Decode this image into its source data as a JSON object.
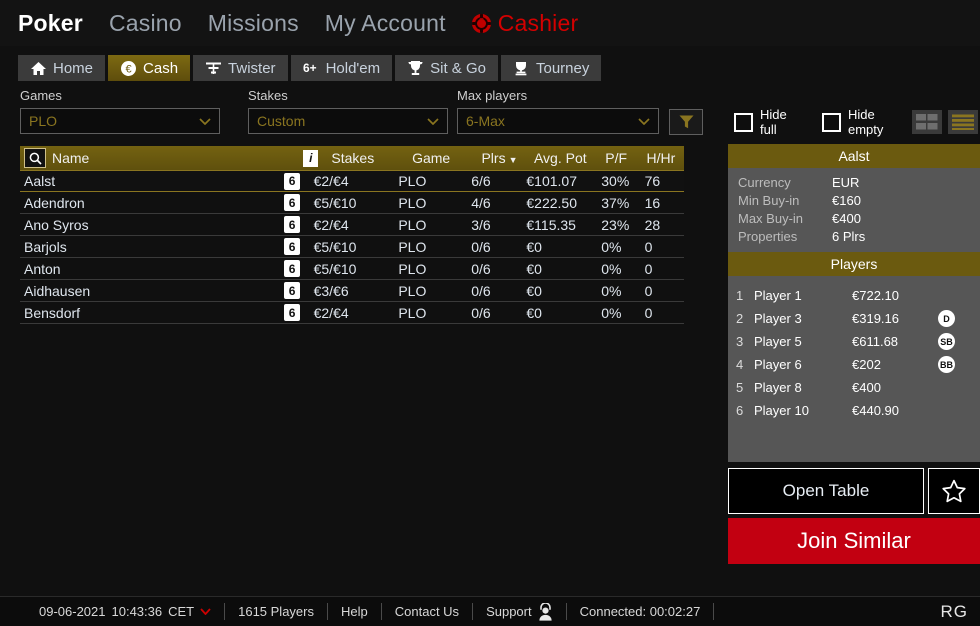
{
  "nav": {
    "items": [
      {
        "label": "Poker",
        "active": true
      },
      {
        "label": "Casino",
        "active": false
      },
      {
        "label": "Missions",
        "active": false
      },
      {
        "label": "My Account",
        "active": false
      }
    ],
    "cashier_label": "Cashier",
    "cashier_icon": "poker-chip-icon"
  },
  "tabs": [
    {
      "label": "Home",
      "icon": "home-icon",
      "active": false
    },
    {
      "label": "Cash",
      "icon": "euro-coin-icon",
      "active": true
    },
    {
      "label": "Twister",
      "icon": "twister-icon",
      "active": false
    },
    {
      "label": "Hold'em",
      "icon": "six-plus-icon",
      "active": false
    },
    {
      "label": "Sit & Go",
      "icon": "trophy-icon",
      "active": false
    },
    {
      "label": "Tourney",
      "icon": "cup-icon",
      "active": false
    }
  ],
  "filters": {
    "games": {
      "label": "Games",
      "value": "PLO"
    },
    "stakes": {
      "label": "Stakes",
      "value": "Custom"
    },
    "max_players": {
      "label": "Max players",
      "value": "6-Max"
    },
    "filter_icon": "funnel-icon"
  },
  "lobby": {
    "headers": {
      "search_icon": "magnifier-icon",
      "name": "Name",
      "info_icon": "info-icon",
      "stakes": "Stakes",
      "game": "Game",
      "plrs": "Plrs",
      "sort_indicator": "▼",
      "avg_pot": "Avg. Pot",
      "pf": "P/F",
      "hhr": "H/Hr"
    },
    "rows": [
      {
        "name": "Aalst",
        "badge": "6",
        "stakes": "€2/€4",
        "game": "PLO",
        "plrs": "6/6",
        "avg_pot": "€101.07",
        "pf": "30%",
        "hhr": "76",
        "selected": true
      },
      {
        "name": "Adendron",
        "badge": "6",
        "stakes": "€5/€10",
        "game": "PLO",
        "plrs": "4/6",
        "avg_pot": "€222.50",
        "pf": "37%",
        "hhr": "16",
        "selected": false
      },
      {
        "name": "Ano Syros",
        "badge": "6",
        "stakes": "€2/€4",
        "game": "PLO",
        "plrs": "3/6",
        "avg_pot": "€115.35",
        "pf": "23%",
        "hhr": "28",
        "selected": false
      },
      {
        "name": "Barjols",
        "badge": "6",
        "stakes": "€5/€10",
        "game": "PLO",
        "plrs": "0/6",
        "avg_pot": "€0",
        "pf": "0%",
        "hhr": "0",
        "selected": false
      },
      {
        "name": "Anton",
        "badge": "6",
        "stakes": "€5/€10",
        "game": "PLO",
        "plrs": "0/6",
        "avg_pot": "€0",
        "pf": "0%",
        "hhr": "0",
        "selected": false
      },
      {
        "name": "Aidhausen",
        "badge": "6",
        "stakes": "€3/€6",
        "game": "PLO",
        "plrs": "0/6",
        "avg_pot": "€0",
        "pf": "0%",
        "hhr": "0",
        "selected": false
      },
      {
        "name": "Bensdorf",
        "badge": "6",
        "stakes": "€2/€4",
        "game": "PLO",
        "plrs": "0/6",
        "avg_pot": "€0",
        "pf": "0%",
        "hhr": "0",
        "selected": false
      }
    ]
  },
  "right_panel": {
    "hide_full_label": "Hide\nfull",
    "hide_full_line1": "Hide",
    "hide_full_line2": "full",
    "hide_empty_line1": "Hide",
    "hide_empty_line2": "empty",
    "hide_full_checked": false,
    "hide_empty_checked": false,
    "view_grid_icon": "grid-view-icon",
    "view_list_icon": "list-view-icon",
    "view_active": "list",
    "table_title": "Aalst",
    "info": [
      {
        "key": "Currency",
        "value": "EUR"
      },
      {
        "key": "Min Buy-in",
        "value": "€160"
      },
      {
        "key": "Max Buy-in",
        "value": "€400"
      },
      {
        "key": "Properties",
        "value": "6 Plrs"
      }
    ],
    "players_title": "Players",
    "players": [
      {
        "idx": "1",
        "name": "Player 1",
        "stack": "€722.10",
        "pos": ""
      },
      {
        "idx": "2",
        "name": "Player 3",
        "stack": "€319.16",
        "pos": "D"
      },
      {
        "idx": "3",
        "name": "Player 5",
        "stack": "€611.68",
        "pos": "SB"
      },
      {
        "idx": "4",
        "name": "Player 6",
        "stack": "€202",
        "pos": "BB"
      },
      {
        "idx": "5",
        "name": "Player 8",
        "stack": "€400",
        "pos": ""
      },
      {
        "idx": "6",
        "name": "Player 10",
        "stack": "€440.90",
        "pos": ""
      }
    ],
    "open_table_label": "Open Table",
    "favorite_icon": "star-icon",
    "join_similar_label": "Join Similar"
  },
  "status_bar": {
    "date": "09-06-2021",
    "time": "10:43:36",
    "timezone": "CET",
    "timezone_caret_icon": "chevron-down-icon",
    "players_online": "1615 Players",
    "help": "Help",
    "contact": "Contact Us",
    "support": "Support",
    "support_icon": "headset-person-icon",
    "connected": "Connected: 00:02:27",
    "rg": "RG"
  },
  "colors": {
    "accent_gold": "#6b5a0f",
    "accent_gold_text": "#8a7520",
    "cashier_red": "#d40000",
    "join_red": "#c20011",
    "panel_gray": "#565656",
    "app_bg": "#101010"
  }
}
